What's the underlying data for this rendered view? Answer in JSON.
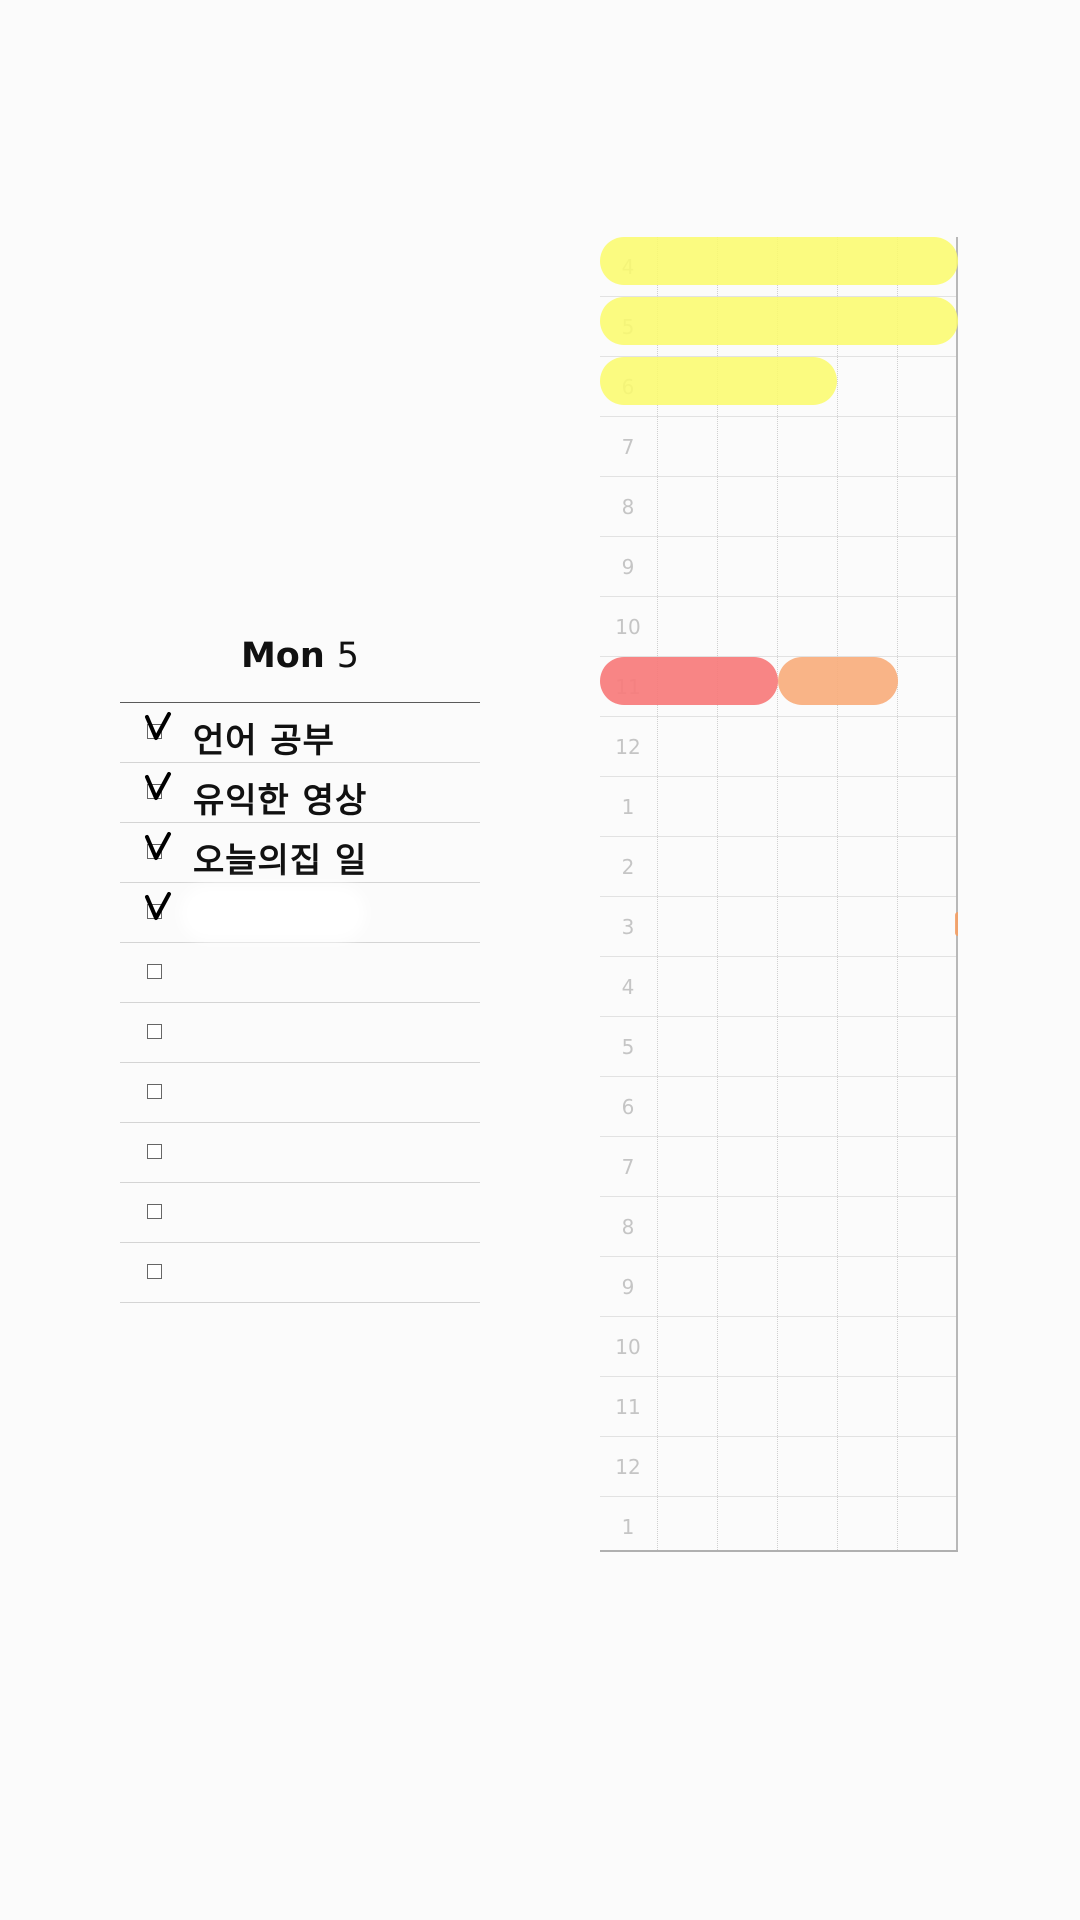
{
  "day": {
    "weekday": "Mon",
    "date": "5"
  },
  "tasks": [
    {
      "checked": true,
      "text": "언어 공부"
    },
    {
      "checked": true,
      "text": "유익한 영상"
    },
    {
      "checked": true,
      "text": "오늘의집 일"
    },
    {
      "checked": true,
      "text": ""
    },
    {
      "checked": false,
      "text": ""
    },
    {
      "checked": false,
      "text": ""
    },
    {
      "checked": false,
      "text": ""
    },
    {
      "checked": false,
      "text": ""
    },
    {
      "checked": false,
      "text": ""
    },
    {
      "checked": false,
      "text": ""
    }
  ],
  "timetable": {
    "hours": [
      "4",
      "5",
      "6",
      "7",
      "8",
      "9",
      "10",
      "11",
      "12",
      "1",
      "2",
      "3",
      "4",
      "5",
      "6",
      "7",
      "8",
      "9",
      "10",
      "11",
      "12",
      "1"
    ],
    "colors": {
      "yellow": "#fafa6e",
      "red": "#f77b7b",
      "orange": "#f9ae7d",
      "grid_line": "#cfcfcf",
      "hour_label": "#c5c5c5"
    }
  }
}
